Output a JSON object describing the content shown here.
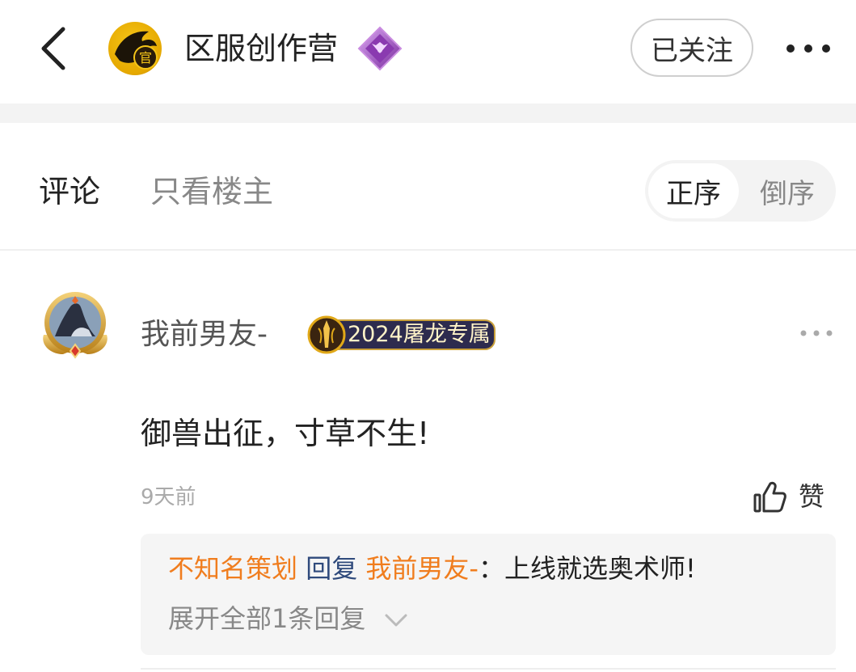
{
  "header": {
    "title": "区服创作营",
    "avatar_glyph": "官",
    "follow_label": "已关注",
    "back_icon": "chevron-left-icon",
    "more_icon": "more-horizontal-icon",
    "verified_badge_icon": "diamond-badge-icon"
  },
  "tabs": {
    "comments": "评论",
    "owner_only": "只看楼主",
    "sort_asc": "正序",
    "sort_desc": "倒序"
  },
  "comment": {
    "username": "我前男友-",
    "badge": "2024屠龙专属",
    "text": "御兽出征，寸草不生!",
    "time": "9天前",
    "like_label": "赞",
    "like_icon": "thumbs-up-icon",
    "reply": {
      "from": "不知名策划",
      "verb": "回复",
      "to": "我前男友-",
      "separator": "：",
      "text": "上线就选奥术师!",
      "expand_label": "展开全部1条回复"
    }
  },
  "colors": {
    "accent_orange": "#f07d1e",
    "reply_navy": "#2f4a7c",
    "badge_dark": "#2d2b4e",
    "gold": "#e0a818"
  }
}
